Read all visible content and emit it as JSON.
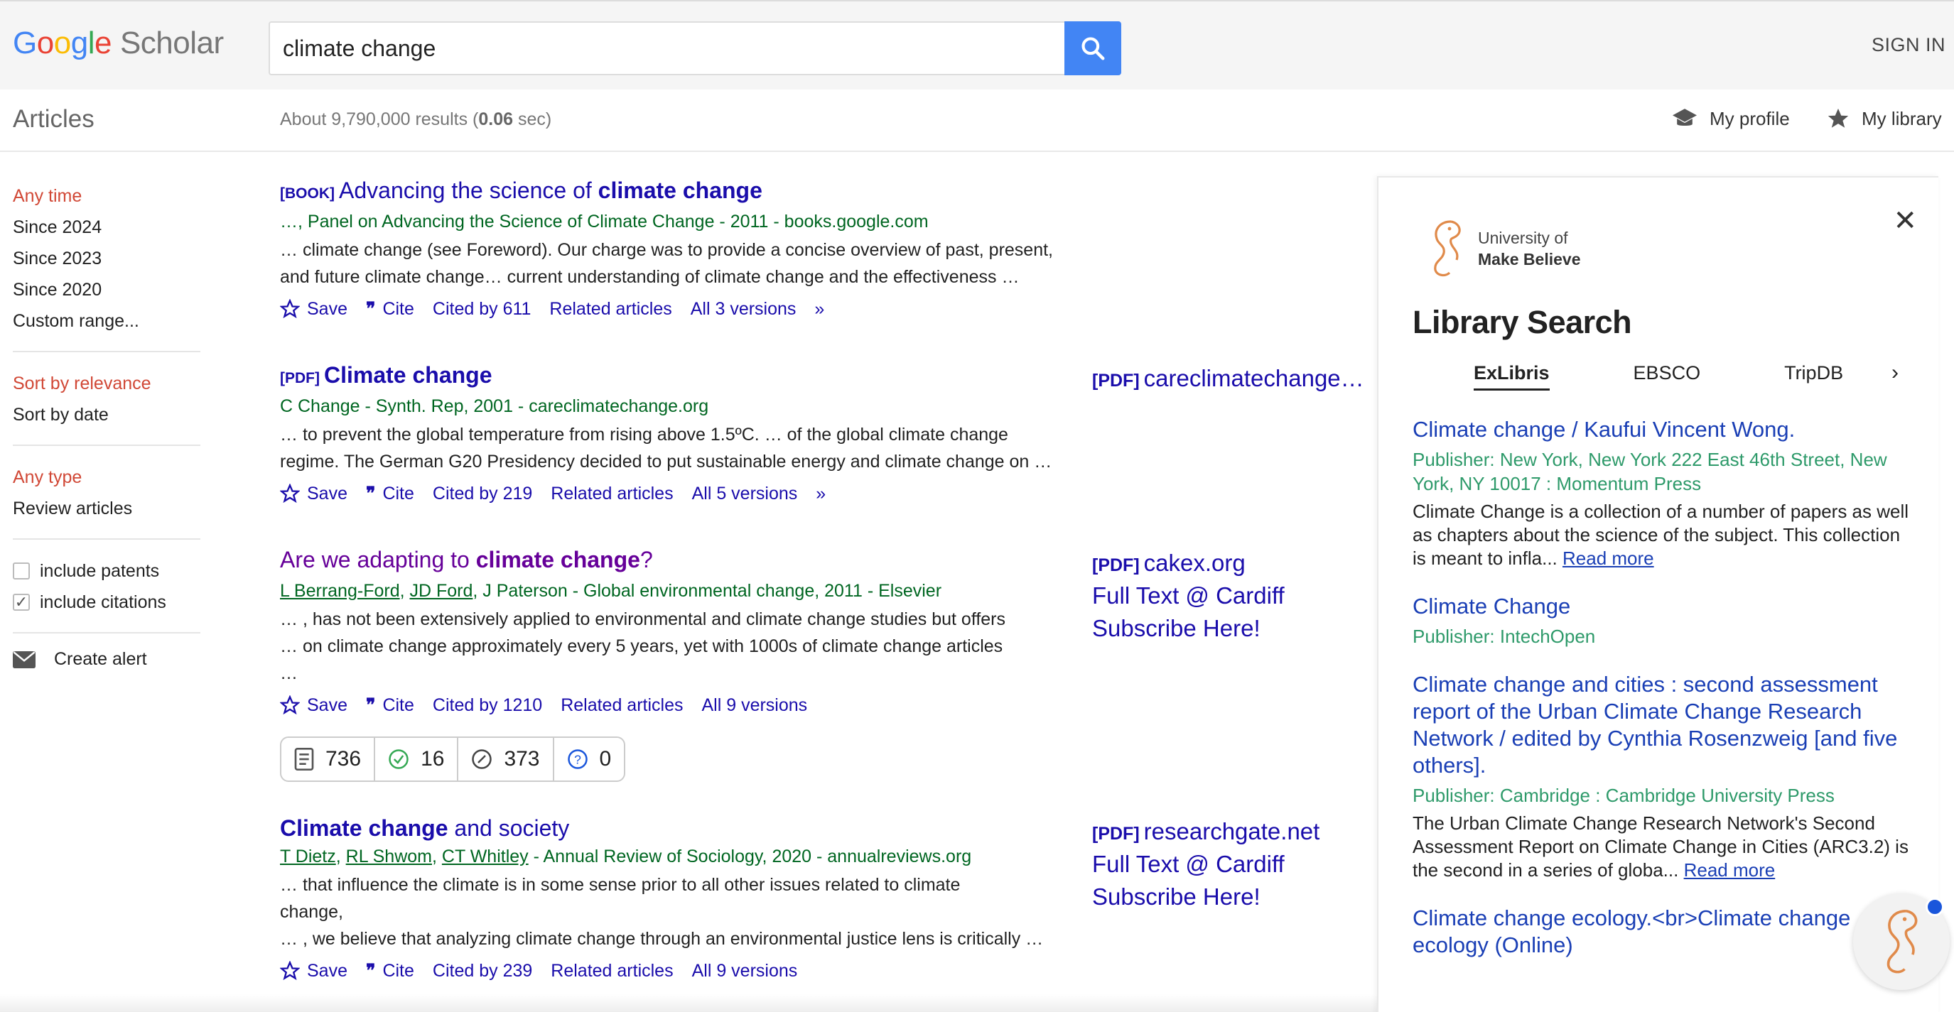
{
  "header": {
    "logo_google": [
      "G",
      "o",
      "o",
      "g",
      "l",
      "e"
    ],
    "logo_scholar": "Scholar",
    "search_value": "climate change",
    "sign_in": "SIGN IN"
  },
  "subbar": {
    "title": "Articles",
    "results_prefix": "About 9,790,000 results (",
    "results_time": "0.06",
    "results_suffix": " sec)",
    "my_profile": "My profile",
    "my_library": "My library"
  },
  "sidebar": {
    "time": [
      "Any time",
      "Since 2024",
      "Since 2023",
      "Since 2020",
      "Custom range..."
    ],
    "sort": [
      "Sort by relevance",
      "Sort by date"
    ],
    "type": [
      "Any type",
      "Review articles"
    ],
    "include_patents": "include patents",
    "include_citations": "include citations",
    "create_alert": "Create alert"
  },
  "results": [
    {
      "tag": "[BOOK]",
      "title_pre": "Advancing the science of ",
      "title_bold": "climate change",
      "title_post": "",
      "meta": "…, Panel on Advancing the Science of Climate Change - 2011 - books.google.com",
      "snippet1": "… climate change (see Foreword). Our charge was to provide a concise overview of past, present,",
      "snippet2": "and future climate change… current understanding of climate change and the effectiveness …",
      "save": "Save",
      "cite": "Cite",
      "cited_by": "Cited by 611",
      "related": "Related articles",
      "versions": "All 3 versions"
    },
    {
      "tag": "[PDF]",
      "title_pre": "",
      "title_bold": "Climate change",
      "title_post": "",
      "meta": "C Change - Synth. Rep, 2001 - careclimatechange.org",
      "snippet1": "… to prevent the global temperature from rising above 1.5ºC. … of the global climate change",
      "snippet2": "regime. The German G20 Presidency decided to put sustainable energy and climate change on …",
      "save": "Save",
      "cite": "Cite",
      "cited_by": "Cited by 219",
      "related": "Related articles",
      "versions": "All 5 versions",
      "side_tag": "[PDF]",
      "side_link": "careclimatechange…"
    },
    {
      "tag": "",
      "title_pre": "Are we adapting to ",
      "title_bold": "climate change",
      "title_post": "?",
      "meta_authors": [
        "L Berrang-Ford",
        "JD Ford"
      ],
      "meta_rest": ", J Paterson - Global environmental change, 2011 - Elsevier",
      "snippet1": "… , has not been extensively applied to environmental and climate change studies but offers",
      "snippet2": "… on climate change approximately every 5 years, yet with 1000s of climate change articles",
      "snippet3": "…",
      "save": "Save",
      "cite": "Cite",
      "cited_by": "Cited by 1210",
      "related": "Related articles",
      "versions": "All 9 versions",
      "metrics": [
        "736",
        "16",
        "373",
        "0"
      ],
      "side_tag": "[PDF]",
      "side_link": "cakex.org",
      "side_full": "Full Text @ Cardiff",
      "side_sub": "Subscribe Here!"
    },
    {
      "tag": "",
      "title_pre": "",
      "title_bold": "Climate change",
      "title_post": " and society",
      "meta_authors": [
        "T Dietz",
        "RL Shwom",
        "CT Whitley"
      ],
      "meta_rest": " - Annual Review of Sociology, 2020 - annualreviews.org",
      "snippet1": "… that influence the climate is in some sense prior to all other issues related to climate",
      "snippet2": "change,",
      "snippet3": "… , we believe that analyzing climate change through an environmental justice lens is critically …",
      "save": "Save",
      "cite": "Cite",
      "cited_by": "Cited by 239",
      "related": "Related articles",
      "versions": "All 9 versions",
      "side_tag": "[PDF]",
      "side_link": "researchgate.net",
      "side_full": "Full Text @ Cardiff",
      "side_sub": "Subscribe Here!"
    }
  ],
  "library": {
    "uni_line1": "University of",
    "uni_line2": "Make Believe",
    "title": "Library Search",
    "tabs": [
      "ExLibris",
      "EBSCO",
      "TripDB"
    ],
    "items": [
      {
        "title": "Climate change / Kaufui Vincent Wong.",
        "publisher": "Publisher: New York, New York 222 East 46th Street, New York, NY 10017 : Momentum Press",
        "desc": "Climate Change is a collection of a number of papers as well as chapters about the science of the subject. This collection is meant to infla...",
        "read_more": "Read more"
      },
      {
        "title": "Climate Change",
        "publisher": "Publisher: IntechOpen"
      },
      {
        "title": "Climate change and cities : second assessment report of the Urban Climate Change Research Network / edited by Cynthia Rosenzweig [and five others].",
        "publisher": "Publisher: Cambridge : Cambridge University Press",
        "desc": "The Urban Climate Change Research Network's Second Assessment Report on Climate Change in Cities (ARC3.2) is the second in a series of globa...",
        "read_more": "Read more"
      },
      {
        "title": "Climate change ecology.<br>Climate change ecology (Online)"
      }
    ]
  },
  "colors": {
    "link": "#1a0dab",
    "visited": "#660099",
    "meta_green": "#006621",
    "active_red": "#d14836",
    "search_blue": "#4285f4"
  }
}
